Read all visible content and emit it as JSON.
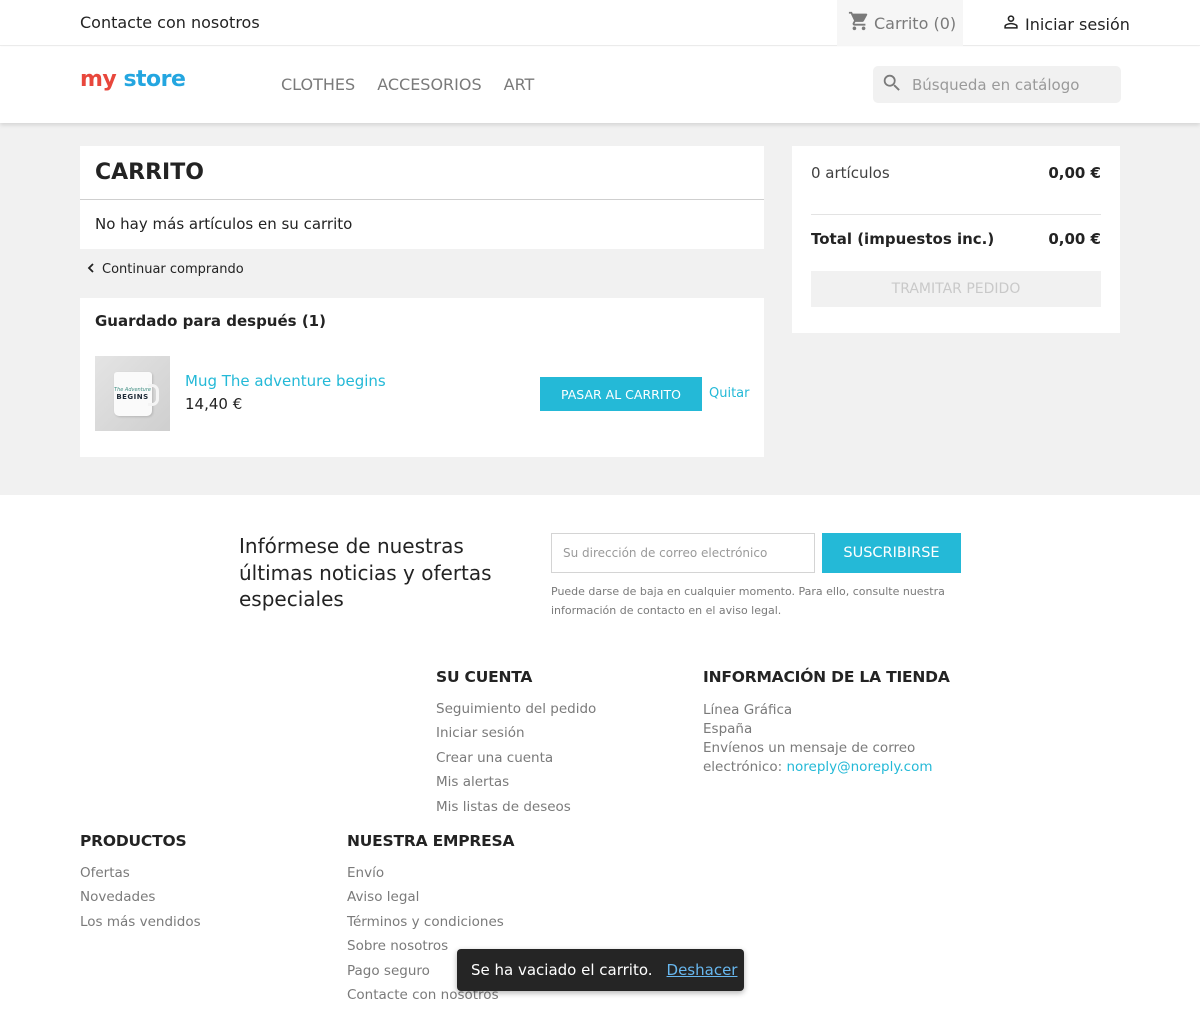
{
  "topbar": {
    "contact": "Contacte con nosotros",
    "cart_label": "Carrito (0)",
    "cart_icon": "cart-icon",
    "signin_label": "Iniciar sesión",
    "user_icon": "user-icon"
  },
  "header": {
    "logo": {
      "word1": "my",
      "word2": "store"
    },
    "nav": [
      "CLOTHES",
      "ACCESORIOS",
      "ART"
    ],
    "search_placeholder": "Búsqueda en catálogo",
    "search_icon": "search-icon"
  },
  "cart": {
    "title": "CARRITO",
    "empty_message": "No hay más artículos en su carrito",
    "continue_label": "Continuar comprando"
  },
  "saved": {
    "title": "Guardado para después (1)",
    "product": {
      "name": "Mug The adventure begins",
      "price": "14,40 €",
      "image_line1": "The Adventure",
      "image_line2": "BEGINS"
    },
    "move_button": "PASAR AL CARRITO",
    "remove_link": "Quitar"
  },
  "summary": {
    "items_label": "0 artículos",
    "items_value": "0,00 €",
    "total_label": "Total (impuestos inc.)",
    "total_value": "0,00 €",
    "checkout_button": "TRAMITAR PEDIDO"
  },
  "newsletter": {
    "title": "Infórmese de nuestras últimas noticias y ofertas especiales",
    "email_placeholder": "Su dirección de correo electrónico",
    "subscribe_button": "SUSCRIBIRSE",
    "note": "Puede darse de baja en cualquier momento. Para ello, consulte nuestra información de contacto en el aviso legal."
  },
  "footer": {
    "account": {
      "title": "SU CUENTA",
      "links": [
        "Seguimiento del pedido",
        "Iniciar sesión",
        "Crear una cuenta",
        "Mis alertas",
        "Mis listas de deseos"
      ]
    },
    "store_info": {
      "title": "INFORMACIÓN DE LA TIENDA",
      "line1": "Línea Gráfica",
      "line2": "España",
      "line3": "Envíenos un mensaje de correo",
      "line4_prefix": "electrónico:",
      "email": "noreply@noreply.com"
    },
    "products": {
      "title": "PRODUCTOS",
      "links": [
        "Ofertas",
        "Novedades",
        "Los más vendidos"
      ]
    },
    "company": {
      "title": "NUESTRA EMPRESA",
      "links": [
        "Envío",
        "Aviso legal",
        "Términos y condiciones",
        "Sobre nosotros",
        "Pago seguro",
        "Contacte con nosotros"
      ]
    }
  },
  "toast": {
    "message": "Se ha vaciado el carrito.",
    "undo": "Deshacer"
  },
  "colors": {
    "accent": "#24b9d7",
    "background_gray": "#f1f1f1",
    "toast_bg": "#252525",
    "undo_link": "#68b7ee"
  }
}
